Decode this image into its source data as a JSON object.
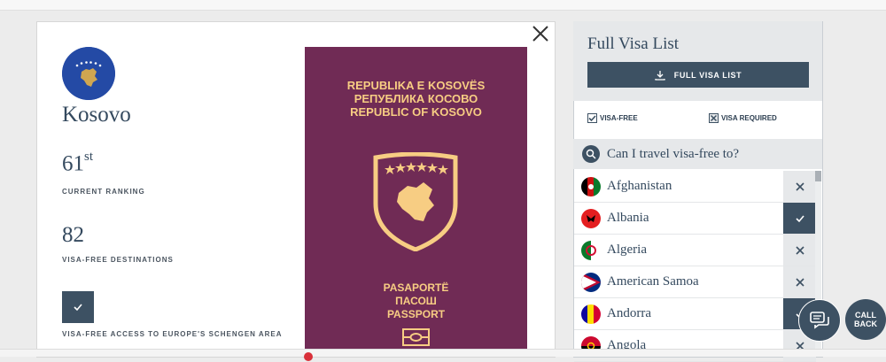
{
  "country": {
    "name": "Kosovo",
    "rank_number": "61",
    "rank_suffix": "st",
    "rank_label": "CURRENT RANKING",
    "destinations": "82",
    "destinations_label": "VISA-FREE DESTINATIONS",
    "schengen_label": "VISA-FREE ACCESS TO EUROPE'S SCHENGEN AREA"
  },
  "passport": {
    "line1": "REPUBLIKA E KOSOVËS",
    "line2": "РЕПУБЛИКА КОСОВО",
    "line3": "REPUBLIC OF KOSOVO",
    "line4": "PASAPORTË",
    "line5": "ПАСОШ",
    "line6": "PASSPORT",
    "color": "#702b55",
    "text_color": "#f7cd83"
  },
  "panel": {
    "title": "Full Visa List",
    "download_label": "FULL VISA LIST",
    "legend_free": "VISA-FREE",
    "legend_required": "VISA REQUIRED",
    "search_placeholder": "Can I travel visa-free to?",
    "countries": [
      {
        "name": "Afghanistan",
        "status": "required"
      },
      {
        "name": "Albania",
        "status": "free"
      },
      {
        "name": "Algeria",
        "status": "required"
      },
      {
        "name": "American Samoa",
        "status": "required"
      },
      {
        "name": "Andorra",
        "status": "free"
      },
      {
        "name": "Angola",
        "status": "required"
      }
    ]
  },
  "floating": {
    "call_line1": "CALL",
    "call_line2": "BACK"
  },
  "colors": {
    "accent": "#3d5163",
    "heading": "#34495e",
    "flag_blue": "#244aa5",
    "flag_gold": "#d0a650"
  },
  "icons": [
    "close-icon",
    "download-icon",
    "check-icon",
    "x-icon",
    "search-icon",
    "chat-icon"
  ]
}
